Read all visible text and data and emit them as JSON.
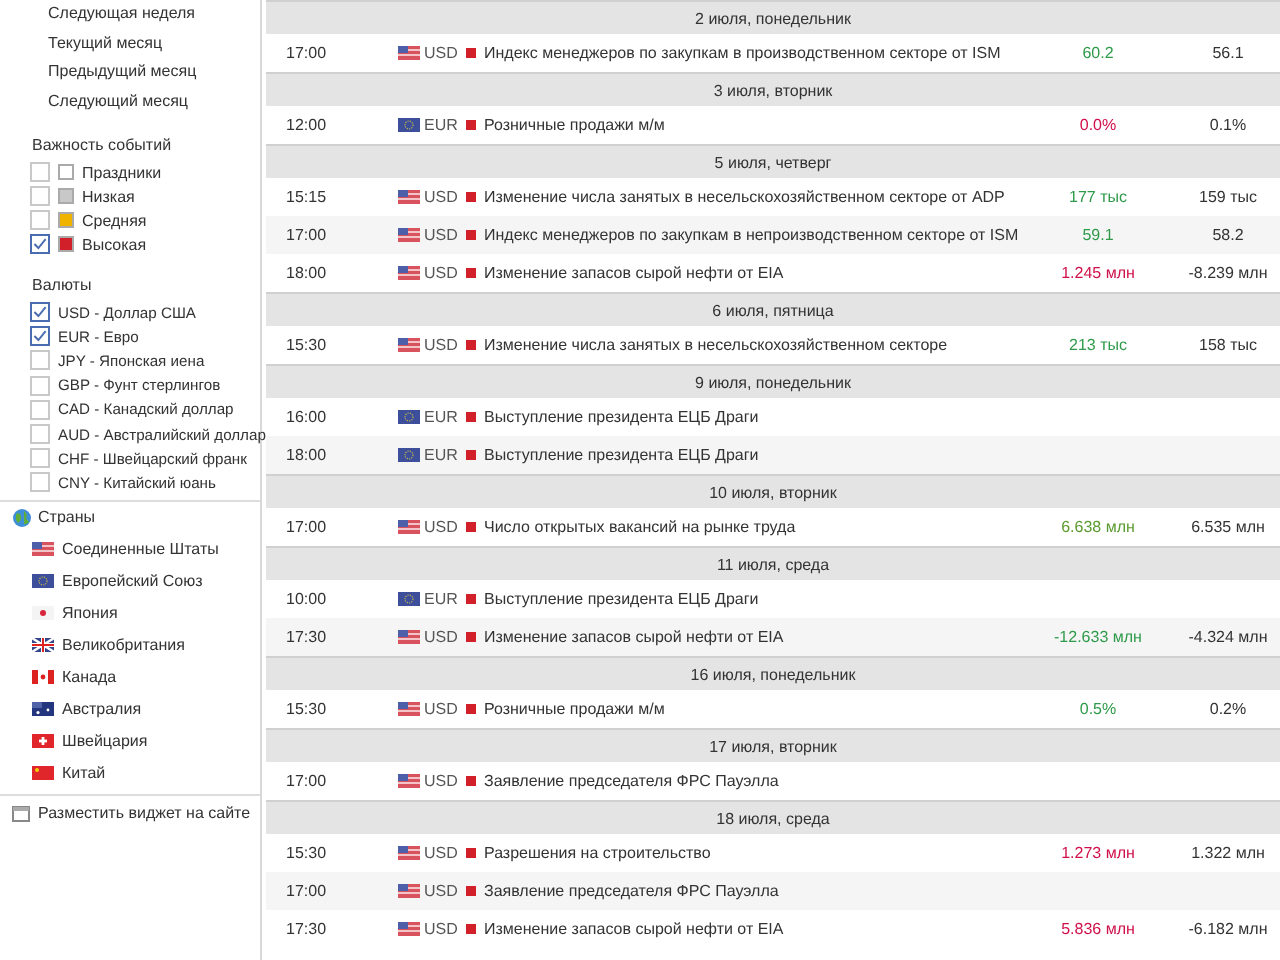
{
  "sidebar": {
    "periods": [
      "Следующая неделя",
      "Текущий месяц",
      "Предыдущий месяц",
      "Следующий месяц"
    ],
    "importance": {
      "title": "Важность событий",
      "items": [
        {
          "label": "Праздники",
          "checked": false,
          "color": "#ffffff"
        },
        {
          "label": "Низкая",
          "checked": false,
          "color": "#c8c8c8"
        },
        {
          "label": "Средняя",
          "checked": false,
          "color": "#f0b400"
        },
        {
          "label": "Высокая",
          "checked": true,
          "color": "#d2202a"
        }
      ]
    },
    "currencies": {
      "title": "Валюты",
      "items": [
        {
          "label": "USD - Доллар США",
          "checked": true
        },
        {
          "label": "EUR - Евро",
          "checked": true
        },
        {
          "label": "JPY - Японская иена",
          "checked": false
        },
        {
          "label": "GBP - Фунт стерлингов",
          "checked": false
        },
        {
          "label": "CAD - Канадский доллар",
          "checked": false
        },
        {
          "label": "AUD - Австралийский доллар",
          "checked": false
        },
        {
          "label": "CHF - Швейцарский франк",
          "checked": false
        },
        {
          "label": "CNY - Китайский юань",
          "checked": false
        }
      ]
    },
    "countries": {
      "title": "Страны",
      "items": [
        "Соединенные Штаты",
        "Европейский Союз",
        "Япония",
        "Великобритания",
        "Канада",
        "Австралия",
        "Швейцария",
        "Китай"
      ]
    },
    "widget_link": "Разместить виджет на сайте"
  },
  "calendar": [
    {
      "date": "2 июля, понедельник",
      "events": [
        {
          "time": "17:00",
          "kind": "us",
          "currency": "USD",
          "title": "Индекс менеджеров по закупкам в производственном секторе от ISM",
          "actual": "60.2",
          "color": "#2e9a4a",
          "forecast": "56.1"
        }
      ]
    },
    {
      "date": "3 июля, вторник",
      "events": [
        {
          "time": "12:00",
          "kind": "eu",
          "currency": "EUR",
          "title": "Розничные продажи м/м",
          "actual": "0.0%",
          "color": "#d0104a",
          "forecast": "0.1%"
        }
      ]
    },
    {
      "date": "5 июля, четверг",
      "events": [
        {
          "time": "15:15",
          "kind": "us",
          "currency": "USD",
          "title": "Изменение числа занятых в несельскохозяйственном секторе от ADP",
          "actual": "177 тыс",
          "color": "#2e9a4a",
          "forecast": "159 тыс"
        },
        {
          "time": "17:00",
          "kind": "us",
          "currency": "USD",
          "title": "Индекс менеджеров по закупкам в непроизводственном секторе от ISM",
          "actual": "59.1",
          "color": "#2e9a4a",
          "forecast": "58.2"
        },
        {
          "time": "18:00",
          "kind": "us",
          "currency": "USD",
          "title": "Изменение запасов сырой нефти от EIA",
          "actual": "1.245 млн",
          "color": "#d0104a",
          "forecast": "-8.239 млн"
        }
      ]
    },
    {
      "date": "6 июля, пятница",
      "events": [
        {
          "time": "15:30",
          "kind": "us",
          "currency": "USD",
          "title": "Изменение числа занятых в несельскохозяйственном секторе",
          "actual": "213 тыс",
          "color": "#2e9a4a",
          "forecast": "158 тыс"
        }
      ]
    },
    {
      "date": "9 июля, понедельник",
      "events": [
        {
          "time": "16:00",
          "kind": "eu",
          "currency": "EUR",
          "title": "Выступление президента ЕЦБ Драги"
        },
        {
          "time": "18:00",
          "kind": "eu",
          "currency": "EUR",
          "title": "Выступление президента ЕЦБ Драги"
        }
      ]
    },
    {
      "date": "10 июля, вторник",
      "events": [
        {
          "time": "17:00",
          "kind": "us",
          "currency": "USD",
          "title": "Число открытых вакансий на рынке труда",
          "actual": "6.638 млн",
          "color": "#5a9a2e",
          "forecast": "6.535 млн"
        }
      ]
    },
    {
      "date": "11 июля, среда",
      "events": [
        {
          "time": "10:00",
          "kind": "eu",
          "currency": "EUR",
          "title": "Выступление президента ЕЦБ Драги"
        },
        {
          "time": "17:30",
          "kind": "us",
          "currency": "USD",
          "title": "Изменение запасов сырой нефти от EIA",
          "actual": "-12.633 млн",
          "color": "#2e9a4a",
          "forecast": "-4.324 млн"
        }
      ]
    },
    {
      "date": "16 июля, понедельник",
      "events": [
        {
          "time": "15:30",
          "kind": "us",
          "currency": "USD",
          "title": "Розничные продажи м/м",
          "actual": "0.5%",
          "color": "#2e9a4a",
          "forecast": "0.2%"
        }
      ]
    },
    {
      "date": "17 июля, вторник",
      "events": [
        {
          "time": "17:00",
          "kind": "us",
          "currency": "USD",
          "title": "Заявление председателя ФРС Пауэлла"
        }
      ]
    },
    {
      "date": "18 июля, среда",
      "events": [
        {
          "time": "15:30",
          "kind": "us",
          "currency": "USD",
          "title": "Разрешения на строительство",
          "actual": "1.273 млн",
          "color": "#d0104a",
          "forecast": "1.322 млн"
        },
        {
          "time": "17:00",
          "kind": "us",
          "currency": "USD",
          "title": "Заявление председателя ФРС Пауэлла"
        },
        {
          "time": "17:30",
          "kind": "us",
          "currency": "USD",
          "title": "Изменение запасов сырой нефти от EIA",
          "actual": "5.836 млн",
          "color": "#d0104a",
          "forecast": "-6.182 млн"
        }
      ]
    }
  ]
}
